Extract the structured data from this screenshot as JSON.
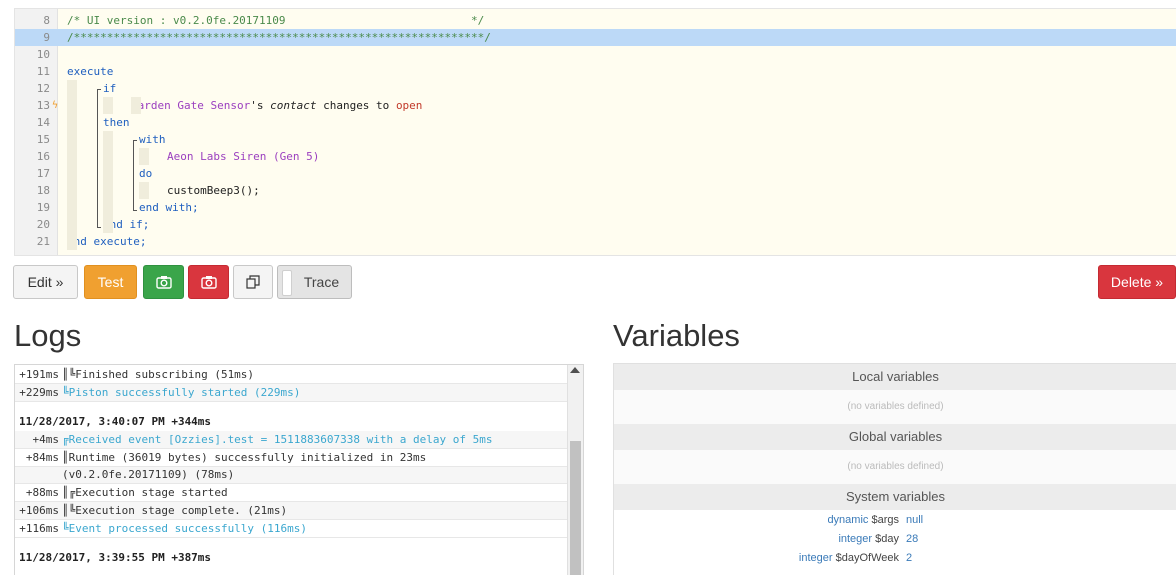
{
  "code": {
    "lines": [
      {
        "n": "8",
        "segs": [
          {
            "c": "cm",
            "t": "/* UI version : v0.2.0fe.20171109                            */"
          }
        ]
      },
      {
        "n": "9",
        "segs": [
          {
            "c": "cm",
            "t": "/**************************************************************/"
          }
        ]
      },
      {
        "n": "10",
        "segs": []
      },
      {
        "n": "11",
        "segs": [
          {
            "c": "kw",
            "t": "execute"
          }
        ]
      },
      {
        "n": "12",
        "segs": [
          {
            "c": "kw",
            "t": "if"
          }
        ]
      },
      {
        "n": "13",
        "segs": [
          {
            "c": "dev",
            "t": "Garden Gate Sensor"
          },
          {
            "c": "plain",
            "t": "'s "
          },
          {
            "c": "it",
            "t": "contact"
          },
          {
            "c": "plain",
            "t": " changes to "
          },
          {
            "c": "val",
            "t": "open"
          }
        ]
      },
      {
        "n": "14",
        "segs": [
          {
            "c": "kw",
            "t": "then"
          }
        ]
      },
      {
        "n": "15",
        "segs": [
          {
            "c": "kw",
            "t": "with"
          }
        ]
      },
      {
        "n": "16",
        "segs": [
          {
            "c": "dev",
            "t": "Aeon Labs Siren (Gen 5)"
          }
        ]
      },
      {
        "n": "17",
        "segs": [
          {
            "c": "kw",
            "t": "do"
          }
        ]
      },
      {
        "n": "18",
        "segs": [
          {
            "c": "plain",
            "t": "customBeep3();"
          }
        ]
      },
      {
        "n": "19",
        "segs": [
          {
            "c": "kw",
            "t": "end with;"
          }
        ]
      },
      {
        "n": "20",
        "segs": [
          {
            "c": "kw",
            "t": "end if;"
          }
        ]
      },
      {
        "n": "21",
        "segs": [
          {
            "c": "kw",
            "t": "end execute;"
          }
        ]
      }
    ]
  },
  "toolbar": {
    "edit_label": "Edit »",
    "test_label": "Test",
    "trace_label": "Trace",
    "delete_label": "Delete »"
  },
  "logs": {
    "title": "Logs",
    "entries": [
      {
        "ts": "+191ms",
        "msg": "║╚Finished subscribing (51ms)",
        "style": "normal"
      },
      {
        "ts": "+229ms",
        "msg": "╚Piston successfully started (229ms)",
        "style": "info"
      },
      {
        "header": "11/28/2017, 3:40:07 PM +344ms"
      },
      {
        "ts": "+4ms",
        "msg": "╔Received event [Ozzies].test = 1511883607338 with a delay of 5ms",
        "style": "info"
      },
      {
        "ts": "+84ms",
        "msg": "║Runtime (36019 bytes) successfully initialized in 23ms",
        "style": "normal"
      },
      {
        "ts": "",
        "msg": "(v0.2.0fe.20171109) (78ms)",
        "style": "normal",
        "cont": true
      },
      {
        "ts": "+88ms",
        "msg": "║╔Execution stage started",
        "style": "normal"
      },
      {
        "ts": "+106ms",
        "msg": "║╚Execution stage complete. (21ms)",
        "style": "normal"
      },
      {
        "ts": "+116ms",
        "msg": "╚Event processed successfully (116ms)",
        "style": "info"
      },
      {
        "header": "11/28/2017, 3:39:55 PM +387ms"
      }
    ]
  },
  "variables": {
    "title": "Variables",
    "local_title": "Local variables",
    "local_empty": "(no variables defined)",
    "global_title": "Global variables",
    "global_empty": "(no variables defined)",
    "system_title": "System variables",
    "system": [
      {
        "type": "dynamic",
        "name": "$args",
        "value": "null"
      },
      {
        "type": "integer",
        "name": "$day",
        "value": "28"
      },
      {
        "type": "integer",
        "name": "$dayOfWeek",
        "value": "2"
      }
    ]
  }
}
